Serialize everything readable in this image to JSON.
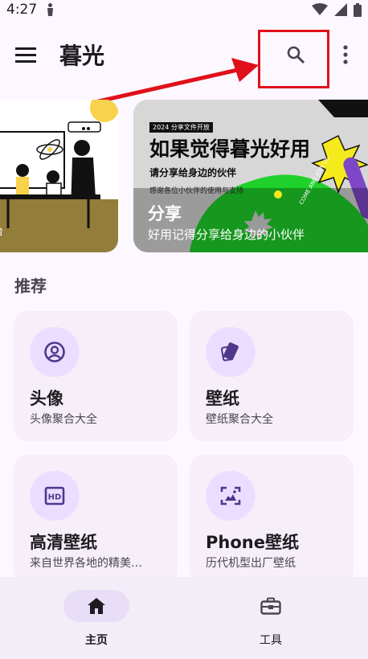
{
  "status_bar": {
    "time": "4:27",
    "icons": [
      "notification-icon",
      "wifi-icon",
      "signal-icon",
      "battery-icon"
    ]
  },
  "app_bar": {
    "title": "暮光",
    "icons": [
      "menu-icon",
      "search-icon",
      "more-vert-icon"
    ]
  },
  "carousel": {
    "left_banner": {
      "caption": "台"
    },
    "right_banner": {
      "ad_badge": "2024 分享文件开放",
      "ad_headline": "如果觉得暮光好用",
      "ad_sub": "请分享给身边的伙伴",
      "ad_small": "感谢各位小伙伴的使用与支持",
      "ad_stamp": "COME AND JOIN US",
      "title": "分享",
      "subtitle": "好用记得分享给身边的小伙伴"
    }
  },
  "section": {
    "title": "推荐"
  },
  "cards": [
    {
      "title": "头像",
      "subtitle": "头像聚合大全",
      "icon": "avatar-icon"
    },
    {
      "title": "壁纸",
      "subtitle": "壁纸聚合大全",
      "icon": "wallpaper-icon"
    },
    {
      "title": "高清壁纸",
      "subtitle": "来自世界各地的精美…",
      "icon": "hd-icon"
    },
    {
      "title": "Phone壁纸",
      "subtitle": "历代机型出厂壁纸",
      "icon": "phone-wallpaper-icon"
    }
  ],
  "bottom_nav": {
    "items": [
      {
        "label": "主页",
        "icon": "home-icon",
        "active": true
      },
      {
        "label": "工具",
        "icon": "toolbox-icon",
        "active": false
      }
    ]
  },
  "colors": {
    "background": "#fdf7ff",
    "card": "#f6eff9",
    "icon_circle": "#eaddff",
    "nav_active": "#e8def8",
    "annotation": "#e0101a"
  }
}
